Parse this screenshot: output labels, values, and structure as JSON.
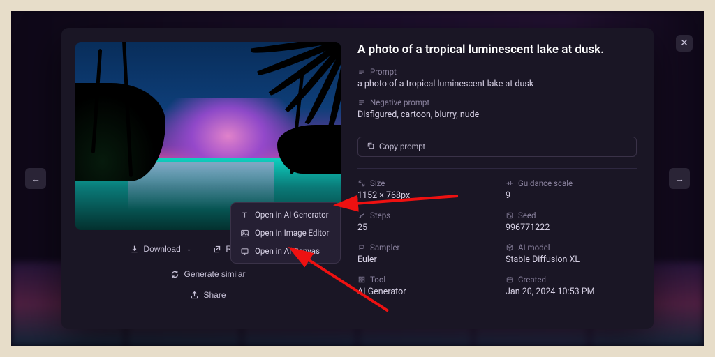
{
  "title": "A photo of a tropical luminescent lake at dusk.",
  "prompt_section": {
    "label": "Prompt",
    "value": "a photo of a tropical luminescent lake at dusk"
  },
  "negative_prompt_section": {
    "label": "Negative prompt",
    "value": "Disfigured, cartoon, blurry, nude"
  },
  "copy_prompt_label": "Copy prompt",
  "meta": {
    "size": {
      "label": "Size",
      "value": "1152 × 768px"
    },
    "guidance": {
      "label": "Guidance scale",
      "value": "9"
    },
    "steps": {
      "label": "Steps",
      "value": "25"
    },
    "seed": {
      "label": "Seed",
      "value": "996771222"
    },
    "sampler": {
      "label": "Sampler",
      "value": "Euler"
    },
    "model": {
      "label": "AI model",
      "value": "Stable Diffusion XL"
    },
    "tool": {
      "label": "Tool",
      "value": "AI Generator"
    },
    "created": {
      "label": "Created",
      "value": "Jan 20, 2024 10:53 PM"
    }
  },
  "actions": {
    "download": "Download",
    "reuse": "Reuse image",
    "generate": "Generate similar",
    "share": "Share"
  },
  "context_menu": {
    "open_generator": "Open in AI Generator",
    "open_editor": "Open in Image Editor",
    "open_canvas": "Open in AI Canvas"
  },
  "icons": {
    "close": "✕",
    "prev": "←",
    "next": "→",
    "chev_down": "⌄",
    "chev_up": "⌃"
  }
}
